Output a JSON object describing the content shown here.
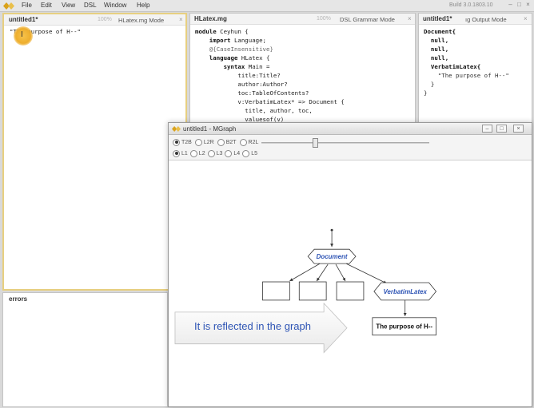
{
  "menubar": {
    "items": [
      "File",
      "Edit",
      "View",
      "DSL",
      "Window",
      "Help"
    ],
    "build": "Build 3.0.1803.10",
    "controls": [
      "–",
      "□",
      "×"
    ]
  },
  "source_pane": {
    "title": "untitled1*",
    "zoom": "100%",
    "mode": "HLatex.mg Mode",
    "close": "×",
    "line": "\"The purpose of H--\""
  },
  "grammar_pane": {
    "title": "HLatex.mg",
    "zoom": "100%",
    "mode": "DSL Grammar Mode",
    "close": "×",
    "lines": [
      {
        "kw": "module",
        "text": " Ceyhun {"
      },
      {
        "kw": "    import",
        "text": " Language;"
      },
      {
        "kw": "",
        "text": ""
      },
      {
        "kw": "",
        "text": "    @{CaseInsensitive}"
      },
      {
        "kw": "    language",
        "text": " HLatex {"
      },
      {
        "kw": "        syntax",
        "text": " Main ="
      },
      {
        "kw": "",
        "text": "            title:Title?"
      },
      {
        "kw": "",
        "text": "            author:Author?"
      },
      {
        "kw": "",
        "text": "            toc:TableOfContents?"
      },
      {
        "kw": "",
        "text": "            v:VerbatimLatex* => Document {"
      },
      {
        "kw": "",
        "text": "              title, author, toc,"
      },
      {
        "kw": "",
        "text": "              valuesof(v)"
      }
    ]
  },
  "output_pane": {
    "title": "untitled1*",
    "mode": "ıg Output Mode",
    "close": "×",
    "lines": [
      "Document{",
      "  null,",
      "  null,",
      "  null,",
      "  VerbatimLatex{",
      "    \"The purpose of H--\"",
      "  }",
      "}"
    ]
  },
  "errors_pane": {
    "title": "errors"
  },
  "mgraph": {
    "title": "untitled1 - MGraph",
    "controls": [
      "–",
      "□",
      "×"
    ],
    "orientation_options": [
      {
        "label": "T2B",
        "selected": true
      },
      {
        "label": "L2R",
        "selected": false
      },
      {
        "label": "B2T",
        "selected": false
      },
      {
        "label": "R2L",
        "selected": false
      }
    ],
    "level_options": [
      {
        "label": "L1",
        "selected": true
      },
      {
        "label": "L2",
        "selected": false
      },
      {
        "label": "L3",
        "selected": false
      },
      {
        "label": "L4",
        "selected": false
      },
      {
        "label": "L5",
        "selected": false
      }
    ],
    "zoom_level": 0.32,
    "nodes": {
      "root": "Document",
      "child": "VerbatimLatex",
      "leaf": "The purpose of H--"
    }
  },
  "callout": {
    "text": "It is reflected in the graph"
  },
  "colors": {
    "accent_node_text": "#2f55b5",
    "highlight": "#eeae2d",
    "logo": "#d9a21c"
  }
}
